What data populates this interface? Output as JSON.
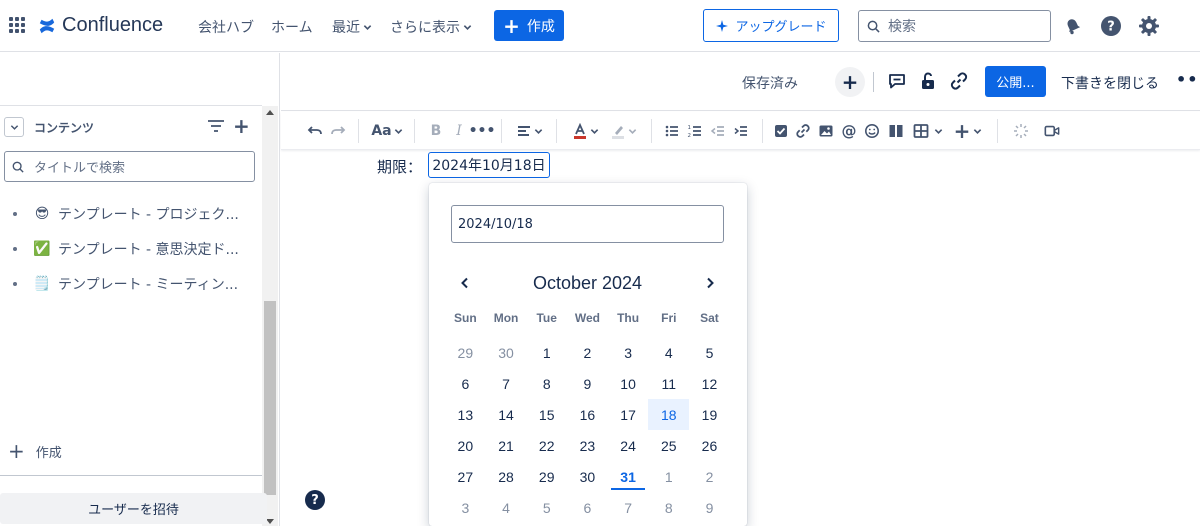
{
  "topnav": {
    "brand": "Confluence",
    "items": [
      {
        "label": "会社ハブ",
        "dropdown": false
      },
      {
        "label": "ホーム",
        "dropdown": false
      },
      {
        "label": "最近",
        "dropdown": true
      },
      {
        "label": "さらに表示",
        "dropdown": true
      }
    ],
    "create_label": "作成",
    "upgrade_label": "アップグレード",
    "search_placeholder": "検索",
    "icons": [
      "app-switcher-icon",
      "notifications-icon",
      "help-icon",
      "settings-icon"
    ]
  },
  "sidebar": {
    "section_title": "コンテンツ",
    "search_placeholder": "タイトルで検索",
    "items": [
      {
        "emoji": "😎",
        "label": "テンプレート - プロジェク..."
      },
      {
        "emoji": "✅",
        "label": "テンプレート - 意思決定ド..."
      },
      {
        "emoji": "🗒️",
        "label": "テンプレート - ミーティン..."
      }
    ],
    "create_label": "作成",
    "invite_label": "ユーザーを招待"
  },
  "editor_header": {
    "saved_status": "保存済み",
    "publish_label": "公開...",
    "close_draft_label": "下書きを閉じる"
  },
  "toolbar": {
    "text_style_label": "Aa",
    "bold_label": "B",
    "italic_label": "I"
  },
  "content": {
    "due_label": "期限：",
    "due_value": "2024年10月18日"
  },
  "datepicker": {
    "input_value": "2024/10/18",
    "month_label": "October 2024",
    "weekdays": [
      "Sun",
      "Mon",
      "Tue",
      "Wed",
      "Thu",
      "Fri",
      "Sat"
    ],
    "weeks": [
      [
        "29",
        "30",
        "1",
        "2",
        "3",
        "4",
        "5"
      ],
      [
        "6",
        "7",
        "8",
        "9",
        "10",
        "11",
        "12"
      ],
      [
        "13",
        "14",
        "15",
        "16",
        "17",
        "18",
        "19"
      ],
      [
        "20",
        "21",
        "22",
        "23",
        "24",
        "25",
        "26"
      ],
      [
        "27",
        "28",
        "29",
        "30",
        "31",
        "1",
        "2"
      ],
      [
        "3",
        "4",
        "5",
        "6",
        "7",
        "8",
        "9"
      ]
    ],
    "selected_day": "18",
    "today_day": "31"
  },
  "colors": {
    "brand_blue": "#0c66e4",
    "selected_bg": "#e9f2ff",
    "text": "#172b4d",
    "subtle_text": "#44546f"
  }
}
